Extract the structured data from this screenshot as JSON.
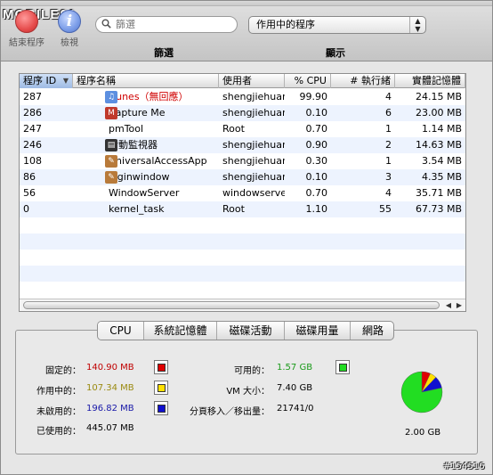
{
  "watermark": "MOBILE01",
  "footer_tag": "#154516",
  "toolbar": {
    "quit_label": "結束程序",
    "inspect_label": "檢視",
    "search_placeholder": "篩選",
    "filter_label": "篩選",
    "process_select_value": "作用中的程序",
    "display_label": "顯示"
  },
  "table": {
    "headers": {
      "pid": "程序 ID",
      "name": "程序名稱",
      "user": "使用者",
      "cpu": "% CPU",
      "threads": "# 執行緒",
      "memory": "實體記憶體"
    },
    "rows": [
      {
        "pid": "287",
        "name": "iTunes（無回應）",
        "user": "shengjiehuar",
        "cpu": "99.90",
        "threads": "4",
        "memory": "24.15 MB",
        "icon": "itunes-icon",
        "alert": true
      },
      {
        "pid": "286",
        "name": "Capture Me",
        "user": "shengjiehuar",
        "cpu": "0.10",
        "threads": "6",
        "memory": "23.00 MB",
        "icon": "capture-me-icon"
      },
      {
        "pid": "247",
        "name": "pmTool",
        "user": "Root",
        "cpu": "0.70",
        "threads": "1",
        "memory": "1.14 MB",
        "icon": ""
      },
      {
        "pid": "246",
        "name": "活動監視器",
        "user": "shengjiehuar",
        "cpu": "0.90",
        "threads": "2",
        "memory": "14.63 MB",
        "icon": "activity-monitor-icon"
      },
      {
        "pid": "108",
        "name": "UniversalAccessApp",
        "user": "shengjiehuar",
        "cpu": "0.30",
        "threads": "1",
        "memory": "3.54 MB",
        "icon": "universal-access-icon"
      },
      {
        "pid": "86",
        "name": "loginwindow",
        "user": "shengjiehuar",
        "cpu": "0.10",
        "threads": "3",
        "memory": "4.35 MB",
        "icon": "loginwindow-icon"
      },
      {
        "pid": "56",
        "name": "WindowServer",
        "user": "windowserve",
        "cpu": "0.70",
        "threads": "4",
        "memory": "35.71 MB",
        "icon": ""
      },
      {
        "pid": "0",
        "name": "kernel_task",
        "user": "Root",
        "cpu": "1.10",
        "threads": "55",
        "memory": "67.73 MB",
        "icon": ""
      }
    ]
  },
  "tabs": [
    {
      "label": "CPU",
      "active": true
    },
    {
      "label": "系統記憶體",
      "active": false
    },
    {
      "label": "磁碟活動",
      "active": false
    },
    {
      "label": "磁碟用量",
      "active": false
    },
    {
      "label": "網路",
      "active": false
    }
  ],
  "memory": {
    "wired_label": "固定的：",
    "wired_value": "140.90 MB",
    "wired_color": "#e00000",
    "active_label": "作用中的：",
    "active_value": "107.34 MB",
    "active_color": "#ffe000",
    "inactive_label": "未啟用的：",
    "inactive_value": "196.82 MB",
    "inactive_color": "#1010d0",
    "used_label": "已使用的：",
    "used_value": "445.07 MB",
    "free_label": "可用的：",
    "free_value": "1.57 GB",
    "free_color": "#22dd22",
    "vm_label": "VM 大小：",
    "vm_value": "7.40 GB",
    "pageins_label": "分頁移入／移出量：",
    "pageins_value": "21741/0",
    "total": "2.00 GB"
  }
}
